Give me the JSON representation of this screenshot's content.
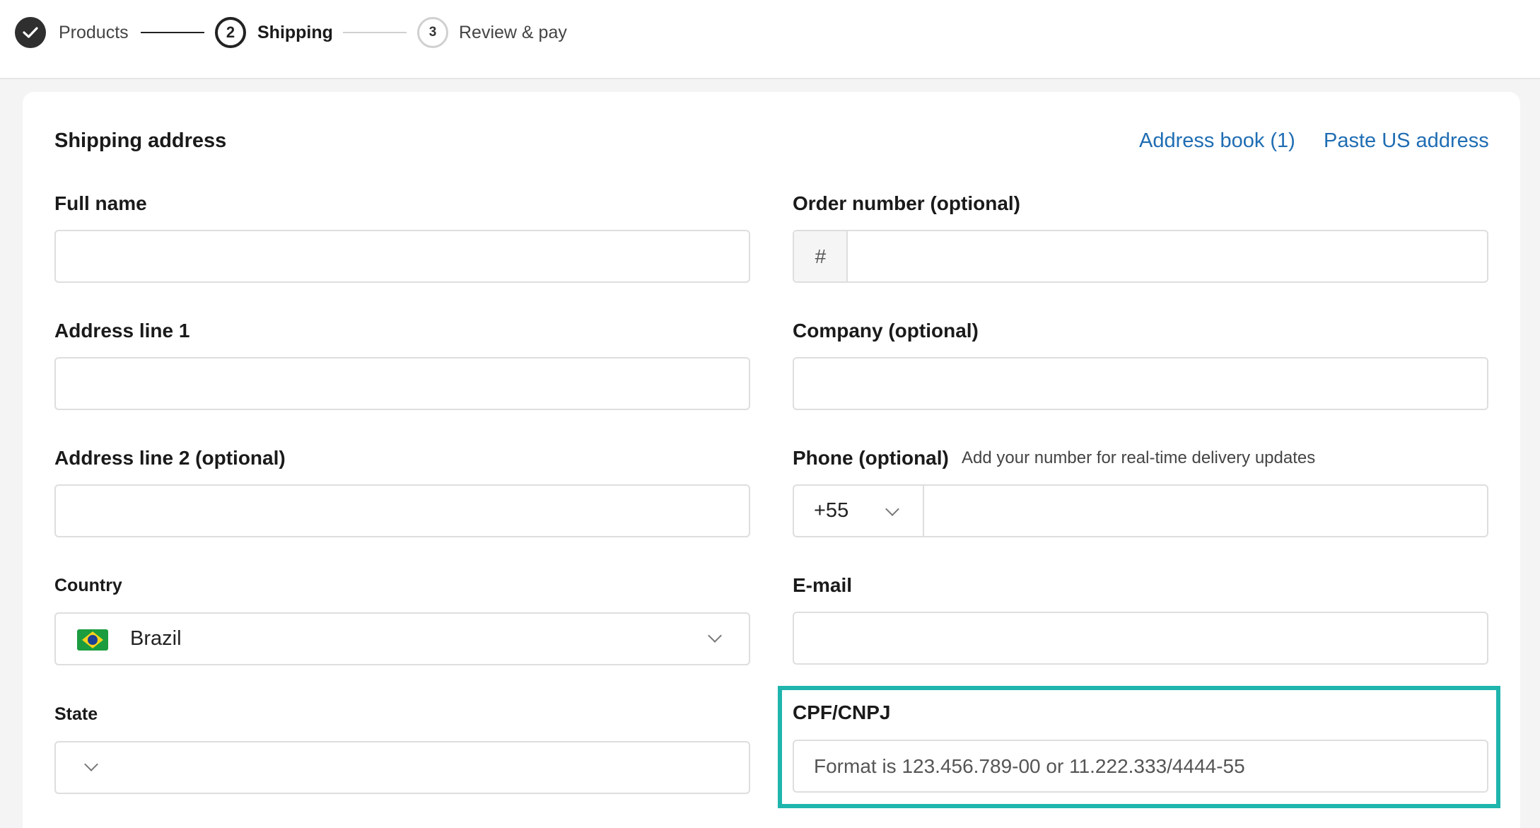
{
  "stepper": {
    "steps": [
      {
        "label": "Products",
        "state": "completed"
      },
      {
        "number": "2",
        "label": "Shipping",
        "state": "current"
      },
      {
        "number": "3",
        "label": "Review & pay",
        "state": "upcoming"
      }
    ]
  },
  "form": {
    "section_title": "Shipping address",
    "links": {
      "address_book": "Address book (1)",
      "paste_us": "Paste US address"
    },
    "full_name": {
      "label": "Full name",
      "value": ""
    },
    "order_number": {
      "label": "Order number (optional)",
      "prefix": "#",
      "value": ""
    },
    "address_line_1": {
      "label": "Address line 1",
      "value": ""
    },
    "company": {
      "label": "Company (optional)",
      "value": ""
    },
    "address_line_2": {
      "label": "Address line 2 (optional)",
      "value": ""
    },
    "phone": {
      "label": "Phone (optional)",
      "hint": "Add your number for real-time delivery updates",
      "country_code": "+55",
      "value": ""
    },
    "country": {
      "label": "Country",
      "value": "Brazil",
      "flag_icon": "brazil-flag-icon"
    },
    "email": {
      "label": "E-mail",
      "value": ""
    },
    "state": {
      "label": "State",
      "value": ""
    },
    "cpf_cnpj": {
      "label": "CPF/CNPJ",
      "placeholder": "Format is 123.456.789-00 or 11.222.333/4444-55",
      "value": ""
    }
  },
  "colors": {
    "link": "#1f6db3",
    "highlight": "#1fb5ad",
    "step_done": "#2f2f2f"
  }
}
